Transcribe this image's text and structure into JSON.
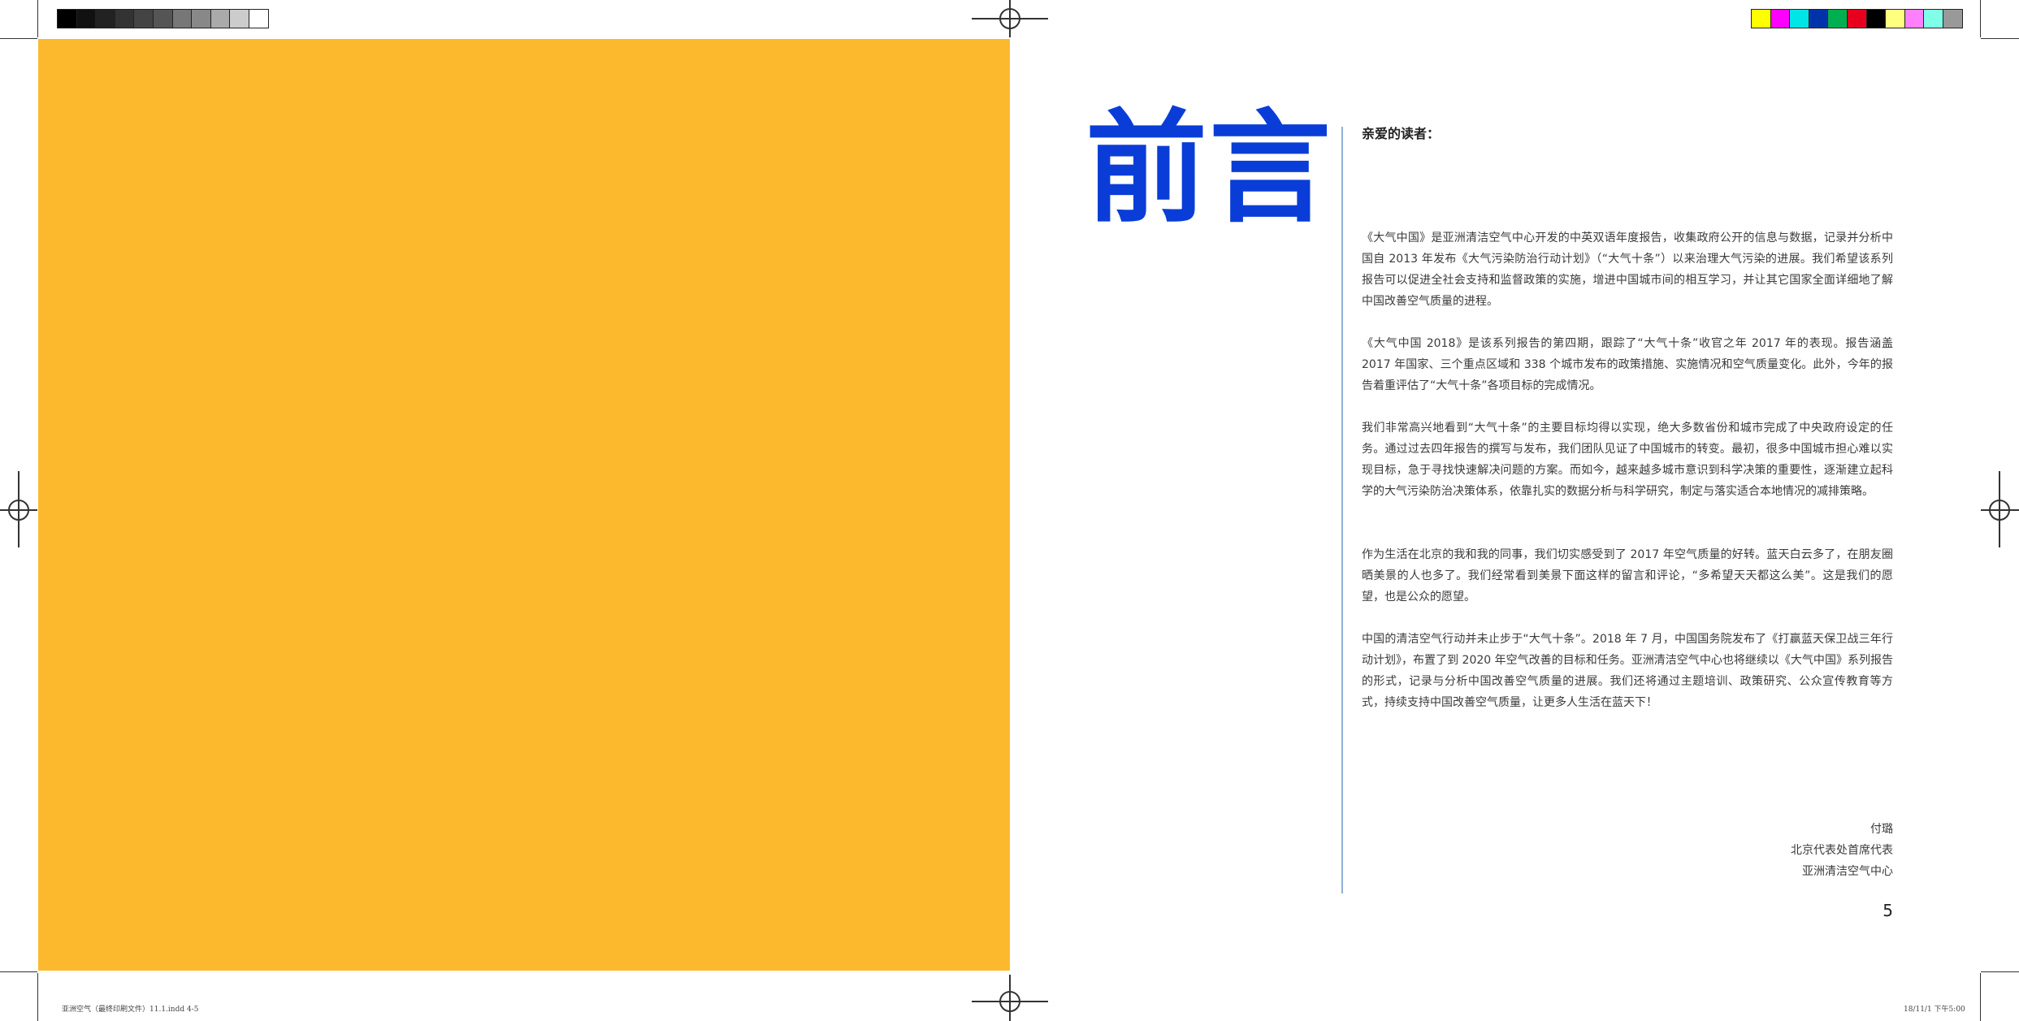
{
  "colors": {
    "left_panel": "#FDB92E",
    "title_blue": "#0A3DD8",
    "rule_blue": "#8FB0D8",
    "grayscale_bar": [
      "#000000",
      "#111111",
      "#222222",
      "#333333",
      "#444444",
      "#555555",
      "#777777",
      "#888888",
      "#aaaaaa",
      "#cccccc",
      "#ffffff"
    ],
    "color_bar": [
      "#FFFF00",
      "#FF00FF",
      "#00E5E5",
      "#0033AA",
      "#00B050",
      "#E6001E",
      "#000000",
      "#FFFF80",
      "#FF80FF",
      "#80FFE8",
      "#999999"
    ]
  },
  "page": {
    "title": "前言",
    "salutation": "亲爱的读者：",
    "paragraphs": [
      "《大气中国》是亚洲清洁空气中心开发的中英双语年度报告，收集政府公开的信息与数据，记录并分析中国自 2013 年发布《大气污染防治行动计划》（“大气十条”）以来治理大气污染的进展。我们希望该系列报告可以促进全社会支持和监督政策的实施，增进中国城市间的相互学习，并让其它国家全面详细地了解中国改善空气质量的进程。",
      "《大气中国 2018》是该系列报告的第四期，跟踪了“大气十条”收官之年 2017 年的表现。报告涵盖 2017 年国家、三个重点区域和 338 个城市发布的政策措施、实施情况和空气质量变化。此外，今年的报告着重评估了“大气十条”各项目标的完成情况。",
      "我们非常高兴地看到“大气十条”的主要目标均得以实现，绝大多数省份和城市完成了中央政府设定的任务。通过过去四年报告的撰写与发布，我们团队见证了中国城市的转变。最初，很多中国城市担心难以实现目标，急于寻找快速解决问题的方案。而如今，越来越多城市意识到科学决策的重要性，逐渐建立起科学的大气污染防治决策体系，依靠扎实的数据分析与科学研究，制定与落实适合本地情况的减排策略。",
      "作为生活在北京的我和我的同事，我们切实感受到了 2017 年空气质量的好转。蓝天白云多了，在朋友圈晒美景的人也多了。我们经常看到美景下面这样的留言和评论，“多希望天天都这么美”。这是我们的愿望，也是公众的愿望。",
      "中国的清洁空气行动并未止步于“大气十条”。2018 年 7 月，中国国务院发布了《打赢蓝天保卫战三年行动计划》，布置了到 2020 年空气改善的目标和任务。亚洲清洁空气中心也将继续以《大气中国》系列报告的形式，记录与分析中国改善空气质量的进展。我们还将通过主题培训、政策研究、公众宣传教育等方式，持续支持中国改善空气质量，让更多人生活在蓝天下！"
    ],
    "signature": [
      "付璐",
      "北京代表处首席代表",
      "亚洲清洁空气中心"
    ],
    "page_number": "5"
  },
  "slug": {
    "left": "亚洲空气（最终印刷文件）11.1.indd  4-5",
    "right": "18/11/1   下午5:00"
  }
}
